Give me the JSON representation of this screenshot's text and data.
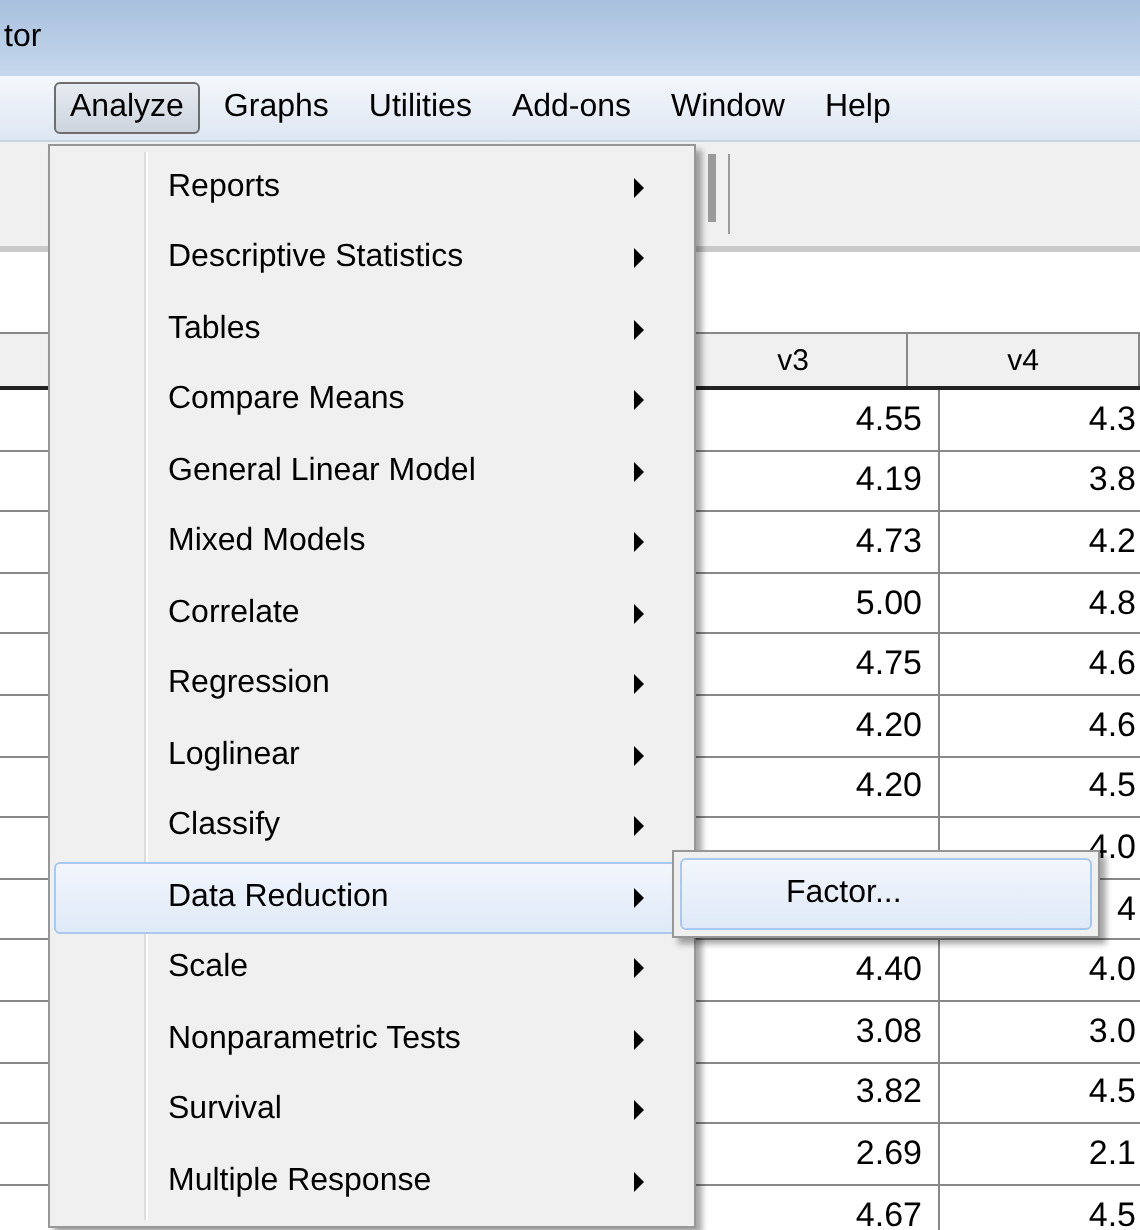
{
  "window": {
    "title": "tor"
  },
  "menubar": [
    {
      "label": "Analyze",
      "selected": true
    },
    {
      "label": "Graphs",
      "selected": false
    },
    {
      "label": "Utilities",
      "selected": false
    },
    {
      "label": "Add-ons",
      "selected": false
    },
    {
      "label": "Window",
      "selected": false
    },
    {
      "label": "Help",
      "selected": false
    }
  ],
  "table": {
    "columns": [
      "v3",
      "v4"
    ],
    "rows": [
      {
        "v3": "4.55",
        "v4": "4.3"
      },
      {
        "v3": "4.19",
        "v4": "3.8"
      },
      {
        "v3": "4.73",
        "v4": "4.2"
      },
      {
        "v3": "5.00",
        "v4": "4.8"
      },
      {
        "v3": "4.75",
        "v4": "4.6"
      },
      {
        "v3": "4.20",
        "v4": "4.6"
      },
      {
        "v3": "4.20",
        "v4": "4.5"
      },
      {
        "v4": "4.0"
      },
      {
        "v4": "4"
      },
      {
        "v3": "4.40",
        "v4": "4.0"
      },
      {
        "v3": "3.08",
        "v4": "3.0"
      },
      {
        "v3": "3.82",
        "v4": "4.5"
      },
      {
        "v3": "2.69",
        "v4": "2.1"
      },
      {
        "v3": "4.67",
        "v4": "4.5"
      }
    ]
  },
  "menu": {
    "items": [
      {
        "label": "Reports",
        "selected": false
      },
      {
        "label": "Descriptive Statistics",
        "selected": false
      },
      {
        "label": "Tables",
        "selected": false
      },
      {
        "label": "Compare Means",
        "selected": false
      },
      {
        "label": "General Linear Model",
        "selected": false
      },
      {
        "label": "Mixed Models",
        "selected": false
      },
      {
        "label": "Correlate",
        "selected": false
      },
      {
        "label": "Regression",
        "selected": false
      },
      {
        "label": "Loglinear",
        "selected": false
      },
      {
        "label": "Classify",
        "selected": false
      },
      {
        "label": "Data Reduction",
        "selected": true
      },
      {
        "label": "Scale",
        "selected": false
      },
      {
        "label": "Nonparametric Tests",
        "selected": false
      },
      {
        "label": "Survival",
        "selected": false
      },
      {
        "label": "Multiple Response",
        "selected": false
      }
    ]
  },
  "submenu": {
    "items": [
      {
        "label": "Factor...",
        "selected": true
      }
    ]
  }
}
